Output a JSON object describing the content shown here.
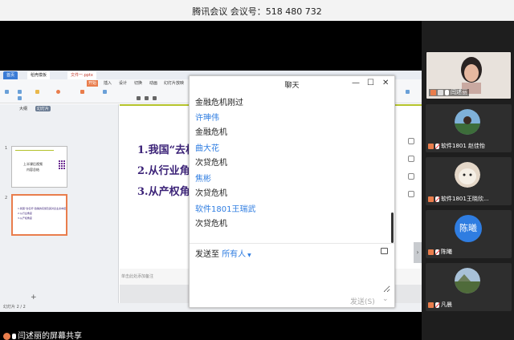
{
  "meeting": {
    "title": "腾讯会议 会议号：518 480 732"
  },
  "wps": {
    "tabs": [
      "首页",
      "稻壳模板",
      "文件一.pptx"
    ],
    "ribbon_tabs": [
      "开始",
      "插入",
      "设计",
      "切换",
      "动画",
      "幻灯片放映"
    ],
    "left_tabs": [
      "大纲",
      "幻灯片"
    ],
    "thumbs": [
      {
        "num": "1",
        "lines": [
          "上半课后视频",
          "内容总结"
        ]
      },
      {
        "num": "2",
        "lines": [
          "1.我国“去杠杆”政策的实施及其对企业资本结构的影响",
          "2.从行业角度",
          "3.从产权角度"
        ]
      }
    ],
    "slide_lines": [
      "1.我国“去杠",
      "2.从行业角",
      "3.从产权角"
    ],
    "notes_placeholder": "单击此处添加备注",
    "status": "幻灯片 2 / 2"
  },
  "chat": {
    "title": "聊天",
    "messages": [
      {
        "text": "金融危机刚过"
      },
      {
        "name": "许珅伟",
        "text": "金融危机"
      },
      {
        "name": "曲大花",
        "text": "次贷危机"
      },
      {
        "name": "焦彬",
        "text": "次贷危机"
      },
      {
        "name": "软件1801王瑞武",
        "text": "次贷危机"
      }
    ],
    "send_to_label": "发送至",
    "send_to_target": "所有人",
    "send_button": "发送(S)"
  },
  "participants": [
    {
      "name": "闫述丽",
      "active": true,
      "mic_muted": false
    },
    {
      "name": "软件1801 赵佳怡",
      "mic_muted": true
    },
    {
      "name": "软件1801王晓欣...",
      "mic_muted": true
    },
    {
      "name": "陈曦",
      "initial": "陈曦",
      "mic_muted": true,
      "color": "#2f7de1"
    },
    {
      "name": "凡晨",
      "mic_muted": true
    }
  ],
  "share_label": "闫述丽的屏幕共享",
  "colors": {
    "accent": "#2f7de1",
    "slide_text": "#3c2378",
    "wps_orange": "#e97d4c"
  }
}
